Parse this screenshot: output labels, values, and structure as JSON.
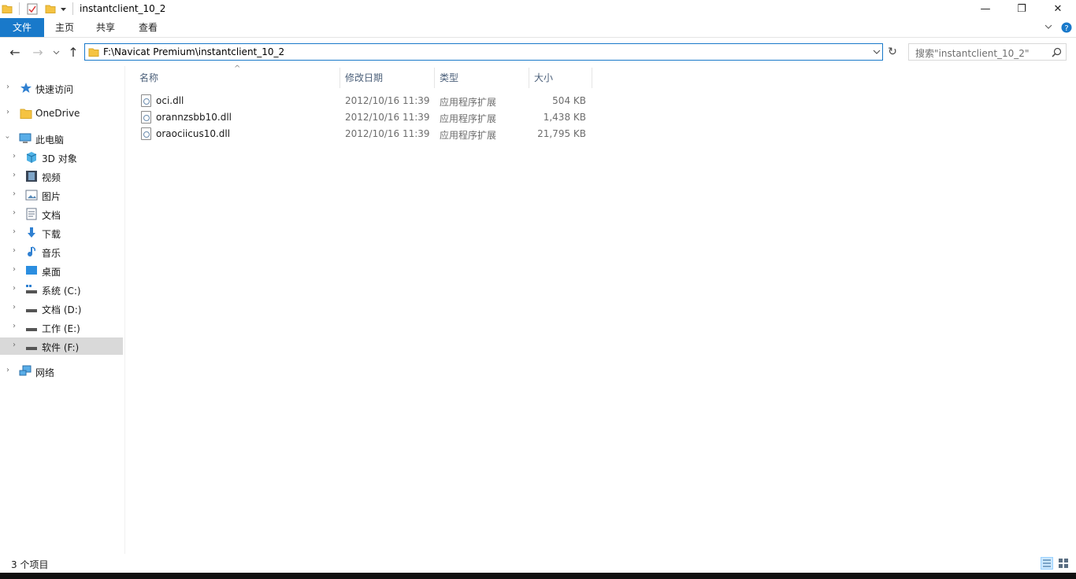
{
  "window": {
    "title": "instantclient_10_2",
    "minimize": "—",
    "maximize": "❐",
    "close": "✕"
  },
  "ribbon": {
    "tabs": [
      "文件",
      "主页",
      "共享",
      "查看"
    ],
    "expand_icon": "chevron-down-icon",
    "help_icon": "question-icon"
  },
  "nav": {
    "address": "F:\\Navicat Premium\\instantclient_10_2",
    "search_placeholder": "搜索\"instantclient_10_2\""
  },
  "sidebar": {
    "quick_access": "快速访问",
    "onedrive": "OneDrive",
    "this_pc": "此电脑",
    "items": [
      "3D 对象",
      "视频",
      "图片",
      "文档",
      "下载",
      "音乐",
      "桌面",
      "系统 (C:)",
      "文档 (D:)",
      "工作 (E:)",
      "软件 (F:)"
    ],
    "network": "网络"
  },
  "list": {
    "columns": [
      "名称",
      "修改日期",
      "类型",
      "大小"
    ],
    "rows": [
      {
        "name": "oci.dll",
        "date": "2012/10/16 11:39",
        "type": "应用程序扩展",
        "size": "504 KB"
      },
      {
        "name": "orannzsbb10.dll",
        "date": "2012/10/16 11:39",
        "type": "应用程序扩展",
        "size": "1,438 KB"
      },
      {
        "name": "oraociicus10.dll",
        "date": "2012/10/16 11:39",
        "type": "应用程序扩展",
        "size": "21,795 KB"
      }
    ]
  },
  "status": {
    "count": "3 个项目"
  },
  "colors": {
    "accent": "#1979ca",
    "selected": "#cce8ff",
    "header_text": "#4c607a"
  }
}
